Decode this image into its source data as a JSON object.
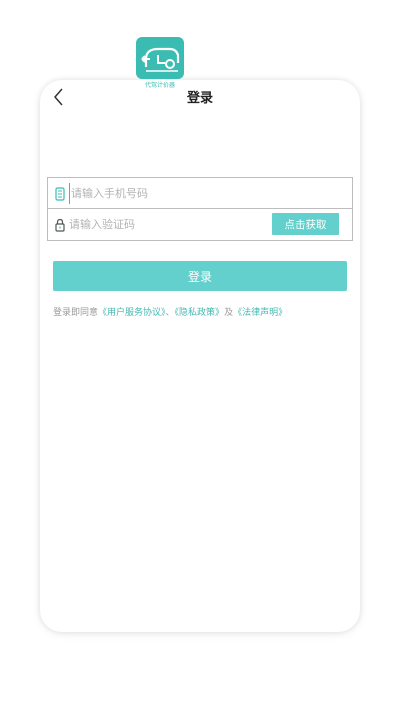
{
  "header": {
    "title": "登录"
  },
  "logo": {
    "caption": "代驾计价器"
  },
  "form": {
    "phone_placeholder": "请输入手机号码",
    "code_placeholder": "请输入验证码",
    "get_code_label": "点击获取"
  },
  "login_label": "登录",
  "agreement": {
    "prefix": "登录即同意",
    "user_agreement": "《用户服务协议》",
    "separator": "、",
    "privacy_policy": "《隐私政策》",
    "conjunction": "及",
    "legal_statement": "《法律声明》"
  },
  "colors": {
    "accent": "#64d0cd",
    "link": "#45b8b1",
    "logo_bg": "#3bbcb2"
  },
  "icons": [
    "chevron-left-icon",
    "car-meter-logo-icon",
    "phone-icon",
    "lock-icon"
  ]
}
